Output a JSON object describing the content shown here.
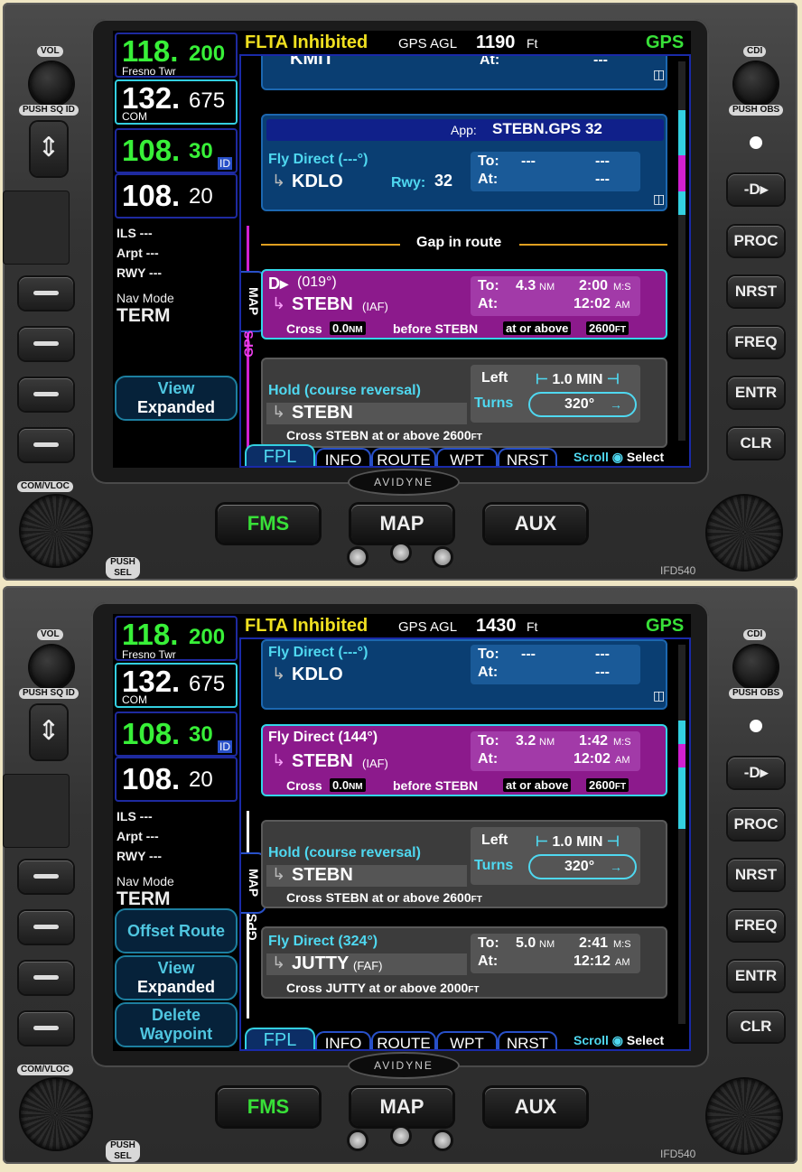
{
  "panels": [
    {
      "status": {
        "flta": "FLTA Inhibited",
        "agl_label": "GPS AGL",
        "agl_value": "1190",
        "agl_unit": "Ft",
        "mode": "GPS"
      },
      "com_active": {
        "big": "118.",
        "small": "200",
        "name": "Fresno Twr"
      },
      "com_standby": {
        "big": "132.",
        "small": "675",
        "tag": "COM"
      },
      "nav_active": {
        "big": "108.",
        "small": "30",
        "tag": "ID"
      },
      "nav_standby": {
        "big": "108.",
        "small": "20"
      },
      "nav_info": {
        "ils": "ILS",
        "ils_val": "---",
        "arpt": "Arpt",
        "arpt_val": "---",
        "rwy": "RWY",
        "rwy_val": "---",
        "navmode_label": "Nav Mode",
        "navmode_val": "TERM"
      },
      "view_button": {
        "line1": "View",
        "line2": "Expanded"
      },
      "partial_wpt": "KMIT",
      "partial_at": "At:",
      "partial_at_val": "---",
      "app_label": "App:",
      "app_value": "STEBN.GPS 32",
      "card_kdlo": {
        "title": "Fly Direct (---°)",
        "wpt": "KDLO",
        "rwy_label": "Rwy:",
        "rwy_val": "32",
        "to": "To:",
        "to_dist": "---",
        "to_time": "---",
        "at": "At:",
        "at_val": "---"
      },
      "gap": "Gap in route",
      "card_stebn": {
        "course": "(019°)",
        "wpt": "STEBN",
        "sub": "(IAF)",
        "to": "To:",
        "dist": "4.3",
        "dist_unit": "NM",
        "time": "2:00",
        "time_unit": "M:S",
        "at": "At:",
        "eta": "12:02",
        "eta_unit": "AM",
        "cross": "Cross",
        "cross_val": "0.0",
        "cross_unit": "NM",
        "before": "before STEBN",
        "alt_cond": "at or above",
        "alt_val": "2600",
        "alt_unit": "FT"
      },
      "card_hold": {
        "title": "Hold (course reversal)",
        "wpt": "STEBN",
        "left": "Left",
        "leg": "1.0  MIN",
        "turns": "Turns",
        "hdg": "320°",
        "cross_line": "Cross STEBN at or above 2600",
        "cross_unit": "FT"
      },
      "side_tab": "MAP",
      "side_gps": "GPS"
    },
    {
      "status": {
        "flta": "FLTA Inhibited",
        "agl_label": "GPS AGL",
        "agl_value": "1430",
        "agl_unit": "Ft",
        "mode": "GPS"
      },
      "com_active": {
        "big": "118.",
        "small": "200",
        "name": "Fresno Twr"
      },
      "com_standby": {
        "big": "132.",
        "small": "675",
        "tag": "COM"
      },
      "nav_active": {
        "big": "108.",
        "small": "30",
        "tag": "ID"
      },
      "nav_standby": {
        "big": "108.",
        "small": "20"
      },
      "nav_info": {
        "ils": "ILS",
        "ils_val": "---",
        "arpt": "Arpt",
        "arpt_val": "---",
        "rwy": "RWY",
        "rwy_val": "---",
        "navmode_label": "Nav Mode",
        "navmode_val": "TERM"
      },
      "offset_button": "Offset Route",
      "view_button": {
        "line1": "View",
        "line2": "Expanded"
      },
      "delete_button": {
        "line1": "Delete",
        "line2": "Waypoint"
      },
      "card_kdlo": {
        "title": "Fly Direct (---°)",
        "wpt": "KDLO",
        "to": "To:",
        "to_dist": "---",
        "to_time": "---",
        "at": "At:",
        "at_val": "---"
      },
      "card_stebn": {
        "title": "Fly Direct (144°)",
        "wpt": "STEBN",
        "sub": "(IAF)",
        "to": "To:",
        "dist": "3.2",
        "dist_unit": "NM",
        "time": "1:42",
        "time_unit": "M:S",
        "at": "At:",
        "eta": "12:02",
        "eta_unit": "AM",
        "cross": "Cross",
        "cross_val": "0.0",
        "cross_unit": "NM",
        "before": "before STEBN",
        "alt_cond": "at or above",
        "alt_val": "2600",
        "alt_unit": "FT"
      },
      "card_hold": {
        "title": "Hold (course reversal)",
        "wpt": "STEBN",
        "left": "Left",
        "leg": "1.0  MIN",
        "turns": "Turns",
        "hdg": "320°",
        "cross_line": "Cross STEBN at or above 2600",
        "cross_unit": "FT"
      },
      "card_jutty": {
        "title": "Fly Direct (324°)",
        "wpt": "JUTTY",
        "sub": "(FAF)",
        "to": "To:",
        "dist": "5.0",
        "dist_unit": "NM",
        "time": "2:41",
        "time_unit": "M:S",
        "at": "At:",
        "eta": "12:12",
        "eta_unit": "AM",
        "cross_line": "Cross JUTTY at or above 2000",
        "cross_unit": "FT"
      },
      "side_tab": "MAP",
      "side_gps": "GPS"
    }
  ],
  "tabs": [
    "FPL",
    "INFO",
    "ROUTE",
    "WPT",
    "NRST"
  ],
  "scroll_hint": {
    "scroll": "Scroll",
    "select": "Select"
  },
  "bezel": {
    "vol": "VOL",
    "push_sq_id": "PUSH SQ ID",
    "com_vloc": "COM/VLOC",
    "push_sel": "PUSH SEL",
    "cdi": "CDI",
    "push_obs": "PUSH OBS",
    "right_buttons": [
      "PROC",
      "NRST",
      "FREQ",
      "ENTR",
      "CLR"
    ],
    "bottom_buttons": [
      "FMS",
      "MAP",
      "AUX"
    ],
    "logo": "AVIDYNE",
    "model": "IFD540"
  },
  "colors": {
    "active_freq": "#38f038",
    "cyan": "#4fd8f0",
    "magenta": "#8c1a8c",
    "status_yellow": "#f0e020",
    "gps_green": "#38e038"
  }
}
